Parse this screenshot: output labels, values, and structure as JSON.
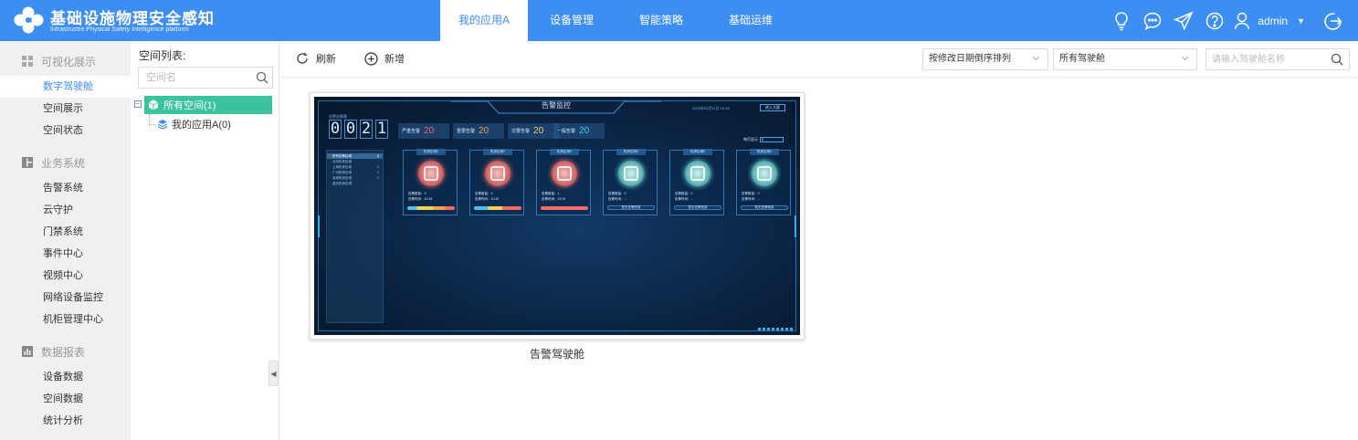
{
  "brand": {
    "title": "基础设施物理安全感知",
    "subtitle": "Infrastructre Physical Safety Intelligence platform"
  },
  "nav": [
    {
      "label": "我的应用A",
      "active": true
    },
    {
      "label": "设备管理"
    },
    {
      "label": "智能策略"
    },
    {
      "label": "基础运维"
    }
  ],
  "header_icons": [
    "lightbulb-icon",
    "chat-icon",
    "send-icon",
    "help-icon",
    "user-icon",
    "logout-icon"
  ],
  "user": {
    "name": "admin"
  },
  "sidebar": {
    "groups": [
      {
        "label": "可视化展示",
        "icon": "grid-icon",
        "items": [
          {
            "label": "数字驾驶舱",
            "active": true
          },
          {
            "label": "空间展示"
          },
          {
            "label": "空间状态"
          }
        ]
      },
      {
        "label": "业务系统",
        "icon": "layout-icon",
        "items": [
          {
            "label": "告警系统"
          },
          {
            "label": "云守护"
          },
          {
            "label": "门禁系统"
          },
          {
            "label": "事件中心"
          },
          {
            "label": "视频中心"
          },
          {
            "label": "网络设备监控"
          },
          {
            "label": "机柜管理中心"
          }
        ]
      },
      {
        "label": "数据报表",
        "icon": "bar-chart-icon",
        "items": [
          {
            "label": "设备数据"
          },
          {
            "label": "空间数据"
          },
          {
            "label": "统计分析"
          }
        ]
      }
    ]
  },
  "tree": {
    "title": "空间列表:",
    "search_placeholder": "空间名",
    "root": "所有空间(1)",
    "child": "我的应用A(0)"
  },
  "toolbar": {
    "refresh": "刷新",
    "add": "新增",
    "sort_select": "按修改日期倒序排列",
    "filter_select": "所有驾驶舱",
    "search_placeholder": "请输入驾驶舱名称"
  },
  "card": {
    "label": "告警驾驶舱",
    "preview": {
      "title": "告警监控",
      "time": "2020年03月11日 10:15",
      "button": "进入大屏",
      "counter_label": "告警总数量",
      "digits": [
        "0",
        "0",
        "2",
        "1"
      ],
      "stats": [
        {
          "label": "严重告警",
          "value": "20",
          "color": "#f46a6a"
        },
        {
          "label": "重要告警",
          "value": "20",
          "color": "#f0a046"
        },
        {
          "label": "次要告警",
          "value": "20",
          "color": "#f2d35a"
        },
        {
          "label": "一般告警",
          "value": "20",
          "color": "#4fc3f0"
        }
      ],
      "threshold_label": "每页显示",
      "threshold_value": "6",
      "side_items": [
        {
          "label": "所有告警区域",
          "count": "6"
        },
        {
          "label": "北京机房区域",
          "count": ""
        },
        {
          "label": "上海机房区域",
          "count": "2"
        },
        {
          "label": "广州机房区域",
          "count": "2"
        },
        {
          "label": "深圳机房区域",
          "count": "2"
        },
        {
          "label": "重庆机房区域",
          "count": ""
        }
      ],
      "tiles": [
        {
          "name": "机房区域1",
          "status": "red",
          "count": "告警数量：3",
          "time": "告警时间：10:15"
        },
        {
          "name": "机房区域2",
          "status": "red",
          "count": "告警数量：3",
          "time": "告警时间：10:15"
        },
        {
          "name": "机房区域3",
          "status": "red",
          "count": "告警数量：1",
          "time": "告警时间：10:15"
        },
        {
          "name": "机房区域4",
          "status": "teal",
          "count": "告警数量：0",
          "time": "告警时间：--",
          "ok": "暂无告警信息"
        },
        {
          "name": "机房区域5",
          "status": "teal",
          "count": "告警数量：0",
          "time": "告警时间：--",
          "ok": "暂无告警信息"
        },
        {
          "name": "机房区域6",
          "status": "teal",
          "count": "告警数量：0",
          "time": "告警时间：--",
          "ok": "暂无告警信息"
        }
      ]
    }
  },
  "colors": {
    "primary": "#3d8ef2",
    "tree_active": "#3bc29f",
    "sidebar_bg": "#f0f0f0"
  }
}
